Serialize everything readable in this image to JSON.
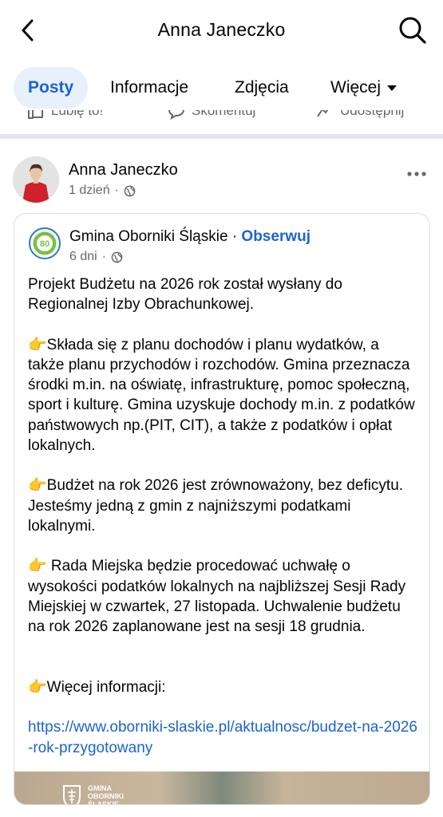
{
  "header": {
    "title": "Anna Janeczko"
  },
  "tabs": [
    {
      "label": "Posty",
      "active": true
    },
    {
      "label": "Informacje"
    },
    {
      "label": "Zdjęcia"
    },
    {
      "label": "Więcej"
    }
  ],
  "actions": {
    "like": "Lubię to!",
    "comment": "Skomentuj",
    "share": "Udostępnij"
  },
  "post": {
    "author": "Anna Janeczko",
    "time": "1 dzień",
    "shared": {
      "page_name": "Gmina Oborniki Śląskie",
      "separator": "·",
      "follow": "Obserwuj",
      "time": "6 dni",
      "paragraphs": [
        "Projekt Budżetu na 2026 rok został wysłany do Regionalnej Izby Obrachunkowej.",
        "👉Składa się z planu dochodów i planu wydatków, a także planu przychodów i rozchodów. Gmina przeznacza środki m.in. na oświatę, infrastrukturę, pomoc społeczną, sport i kulturę. Gmina uzyskuje dochody m.in. z podatków państwowych np.(PIT, CIT), a także z podatków i opłat lokalnych.",
        "👉Budżet na rok 2026 jest zrównoważony, bez deficytu. Jesteśmy jedną z gmin z najniższymi podatkami lokalnymi.",
        "👉 Rada Miejska będzie procedować uchwałę o wysokości podatków lokalnych na najbliższej Sesji Rady Miejskiej w czwartek, 27 listopada. Uchwalenie budżetu na rok 2026 zaplanowane jest na sesji 18 grudnia."
      ],
      "more_label": "👉Więcej informacji:",
      "link": "https://www.oborniki-slaskie.pl/aktualnosc/budzet-na-2026-rok-przygotowany",
      "image_logo_text": "GMINA OBORNIKI ŚLĄSKIE"
    }
  },
  "colors": {
    "accent": "#1b64cc",
    "muted": "#65676b",
    "tab_active_bg": "#e7f0fb"
  }
}
